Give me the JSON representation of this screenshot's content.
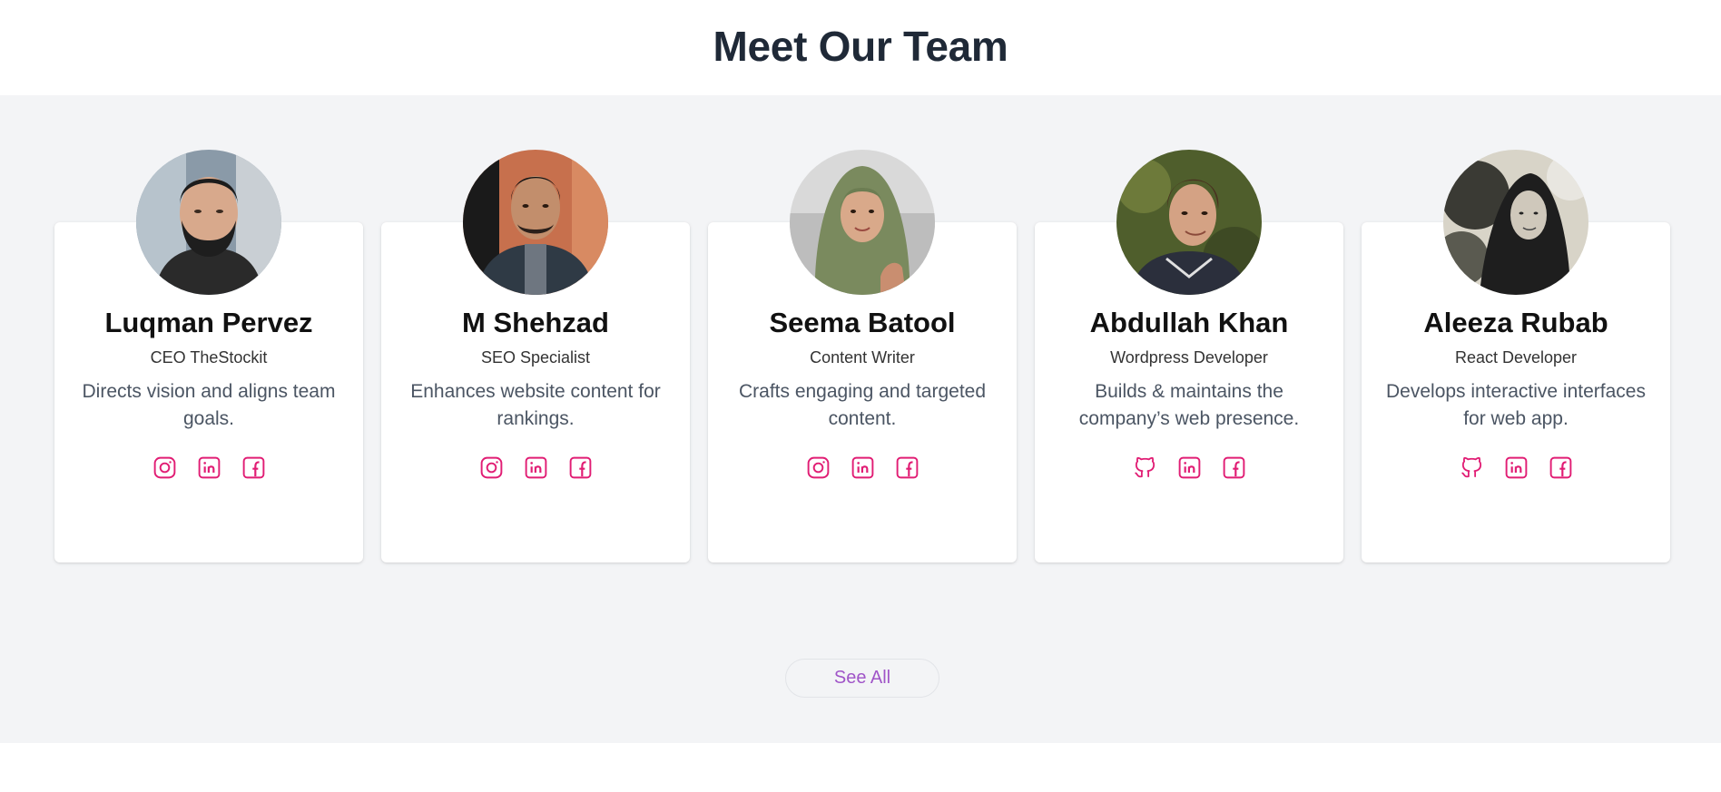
{
  "page": {
    "title": "Meet Our Team"
  },
  "colors": {
    "accent": "#e11d74",
    "button_text": "#a055c8",
    "section_bg": "#f3f4f6",
    "title": "#1f2937"
  },
  "team": [
    {
      "name": "Luqman Pervez",
      "role": "CEO TheStockit",
      "description": "Directs vision and aligns team goals.",
      "socials": [
        "instagram-icon",
        "linkedin-icon",
        "facebook-icon"
      ]
    },
    {
      "name": "M Shehzad",
      "role": "SEO Specialist",
      "description": "Enhances website content for rankings.",
      "socials": [
        "instagram-icon",
        "linkedin-icon",
        "facebook-icon"
      ]
    },
    {
      "name": "Seema Batool",
      "role": "Content Writer",
      "description": "Crafts engaging and targeted content.",
      "socials": [
        "instagram-icon",
        "linkedin-icon",
        "facebook-icon"
      ]
    },
    {
      "name": "Abdullah Khan",
      "role": "Wordpress Developer",
      "description": "Builds & maintains the company’s web presence.",
      "socials": [
        "github-icon",
        "linkedin-icon",
        "facebook-icon"
      ]
    },
    {
      "name": "Aleeza Rubab",
      "role": "React Developer",
      "description": "Develops interactive interfaces for web app.",
      "socials": [
        "github-icon",
        "linkedin-icon",
        "facebook-icon"
      ]
    }
  ],
  "see_all_label": "See All"
}
